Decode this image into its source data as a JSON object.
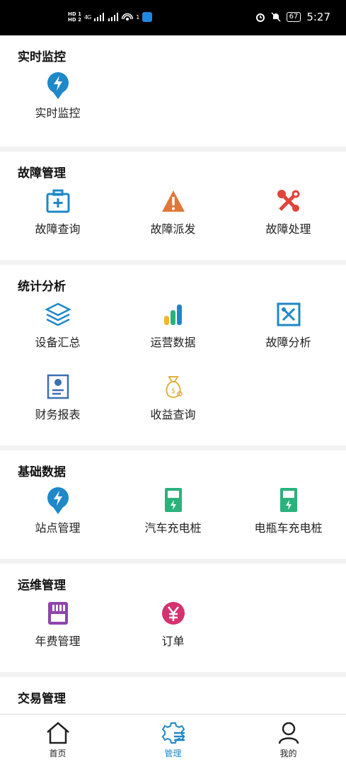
{
  "status_bar": {
    "sim1": "HD 1",
    "sim2": "HD 2",
    "signal": "4G",
    "hotspot_count": "1",
    "battery": "67",
    "time": "5:27"
  },
  "sections": [
    {
      "title": "实时监控",
      "items": [
        {
          "label": "实时监控",
          "icon": "lightning-pin-icon"
        }
      ]
    },
    {
      "title": "故障管理",
      "items": [
        {
          "label": "故障查询",
          "icon": "medical-kit-icon"
        },
        {
          "label": "故障派发",
          "icon": "warning-icon"
        },
        {
          "label": "故障处理",
          "icon": "tools-icon"
        }
      ]
    },
    {
      "title": "统计分析",
      "items": [
        {
          "label": "设备汇总",
          "icon": "layers-icon"
        },
        {
          "label": "运营数据",
          "icon": "bar-chart-icon"
        },
        {
          "label": "故障分析",
          "icon": "wrench-box-icon"
        },
        {
          "label": "财务报表",
          "icon": "finance-doc-icon"
        },
        {
          "label": "收益查询",
          "icon": "money-bag-icon"
        }
      ]
    },
    {
      "title": "基础数据",
      "items": [
        {
          "label": "站点管理",
          "icon": "lightning-pin-icon"
        },
        {
          "label": "汽车充电桩",
          "icon": "car-charger-icon"
        },
        {
          "label": "电瓶车充电桩",
          "icon": "ebike-charger-icon"
        }
      ]
    },
    {
      "title": "运维管理",
      "items": [
        {
          "label": "年费管理",
          "icon": "sd-card-icon"
        },
        {
          "label": "订单",
          "icon": "yuan-circle-icon"
        }
      ]
    },
    {
      "title": "交易管理",
      "items": []
    }
  ],
  "tab_bar": {
    "tabs": [
      {
        "label": "首页",
        "icon": "home-icon"
      },
      {
        "label": "管理",
        "icon": "gear-list-icon",
        "active": true
      },
      {
        "label": "我的",
        "icon": "person-icon"
      }
    ]
  },
  "colors": {
    "accent": "#1e88c8",
    "warning": "#e0773a",
    "danger": "#e0443a",
    "green": "#2ab27b",
    "purple": "#8e44ad",
    "pink": "#d63170",
    "gold": "#e0b040"
  }
}
